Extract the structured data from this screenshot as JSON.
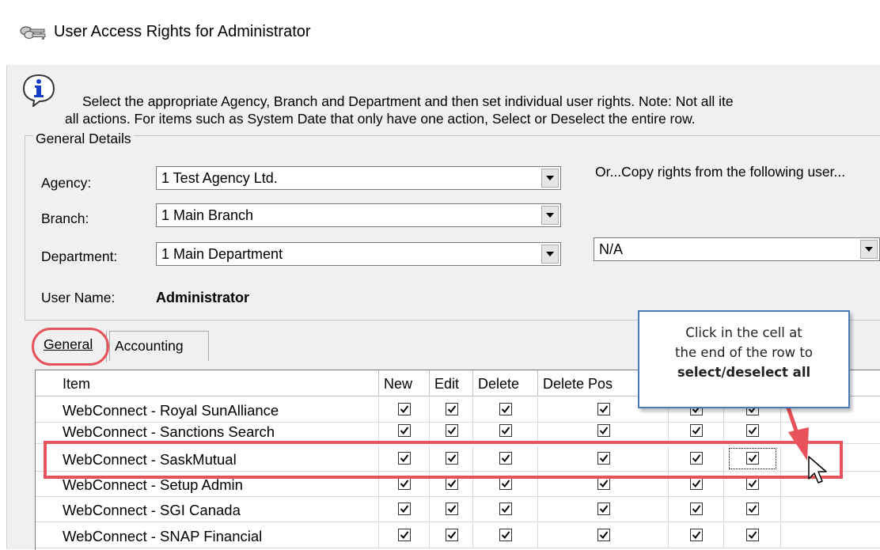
{
  "window": {
    "title": "User Access Rights for Administrator",
    "title_icon": "keys-icon"
  },
  "instructions": {
    "line1": "Select the appropriate Agency, Branch and Department and then set individual user rights.  Note:  Not all ite",
    "line2": "all actions.  For items such as System Date that only have one action, Select or Deselect the entire row."
  },
  "general_details": {
    "legend": "General Details",
    "agency_label": "Agency:",
    "agency_value": "1 Test Agency Ltd.",
    "branch_label": "Branch:",
    "branch_value": "1 Main Branch",
    "department_label": "Department:",
    "department_value": "1 Main Department",
    "user_name_label": "User Name:",
    "user_name_value": "Administrator",
    "copy_rights_label": "Or...Copy rights from the following user...",
    "copy_rights_value": "N/A"
  },
  "tabs": [
    {
      "label": "General",
      "active": true
    },
    {
      "label": "Accounting",
      "active": false
    }
  ],
  "grid": {
    "columns": [
      "Item",
      "New",
      "Edit",
      "Delete",
      "Delete Pos",
      "",
      "",
      ""
    ],
    "rows": [
      {
        "item": "WebConnect - Royal SunAlliance",
        "checks": [
          true,
          true,
          true,
          true,
          true,
          true
        ]
      },
      {
        "item": "WebConnect - Sanctions Search",
        "checks": [
          true,
          true,
          true,
          true,
          true,
          true
        ]
      },
      {
        "item": "WebConnect - SaskMutual",
        "checks": [
          true,
          true,
          true,
          true,
          true,
          true
        ]
      },
      {
        "item": "WebConnect - Setup Admin",
        "checks": [
          true,
          true,
          true,
          true,
          true,
          true
        ]
      },
      {
        "item": "WebConnect - SGI Canada",
        "checks": [
          true,
          true,
          true,
          true,
          true,
          true
        ]
      },
      {
        "item": "WebConnect - SNAP Financial",
        "checks": [
          true,
          true,
          true,
          true,
          true,
          true
        ]
      }
    ]
  },
  "callout": {
    "line1": "Click in the cell at",
    "line2": "the end of the row to",
    "line3": "select/deselect all"
  },
  "colors": {
    "annotation_red": "#e8525a",
    "callout_border": "#4a7ab8",
    "dialog_background": "#f0f0f0"
  }
}
